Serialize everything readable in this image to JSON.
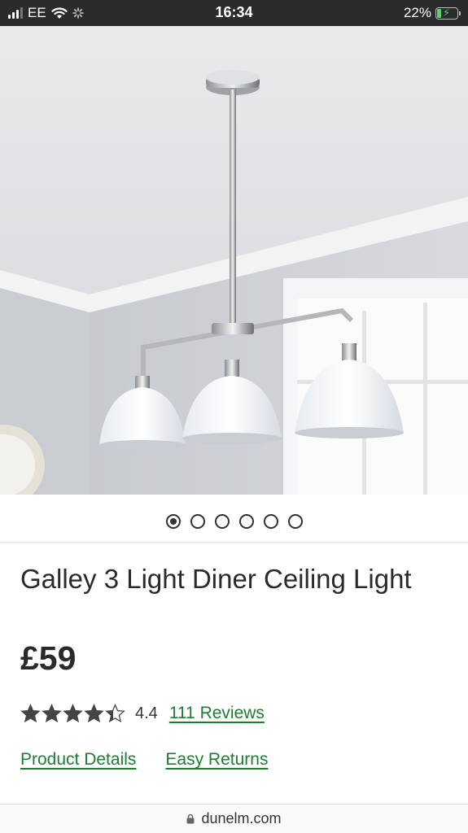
{
  "status_bar": {
    "carrier": "EE",
    "time": "16:34",
    "battery_percent": "22%",
    "battery_level": 0.22,
    "charging": true
  },
  "product": {
    "title": "Galley 3 Light Diner Ceiling Light",
    "price": "£59",
    "rating": {
      "value": "4.4",
      "stars_filled": 4.4,
      "stars_total": 5,
      "reviews_label": "111 Reviews"
    },
    "links": {
      "product_details": "Product Details",
      "easy_returns": "Easy Returns"
    }
  },
  "carousel": {
    "total_images": 6,
    "active_index": 0
  },
  "browser": {
    "url": "dunelm.com"
  },
  "colors": {
    "link": "#1e7d32",
    "status_bar_bg": "#2b2b2b",
    "battery_green": "#4cd964"
  }
}
